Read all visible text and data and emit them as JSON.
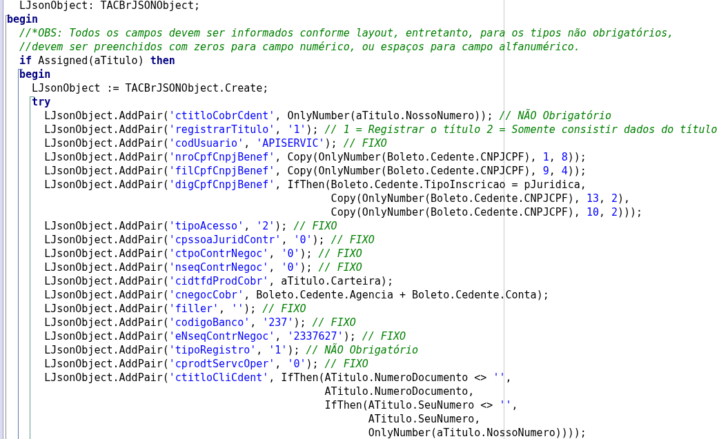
{
  "editor": {
    "lines": [
      {
        "tokens": [
          {
            "kind": "plain",
            "text": "  LJsonObject: TACBrJSONObject;"
          }
        ]
      },
      {
        "tokens": [
          {
            "kind": "keyword",
            "text": "begin"
          }
        ]
      },
      {
        "tokens": [
          {
            "kind": "comment",
            "text": "  //*OBS: Todos os campos devem ser informados conforme layout, entretanto, para os tipos não obrigatórios,"
          }
        ]
      },
      {
        "tokens": [
          {
            "kind": "comment",
            "text": "  //devem ser preenchidos com zeros para campo numérico, ou espaços para campo alfanumérico."
          }
        ]
      },
      {
        "tokens": [
          {
            "kind": "keyword",
            "text": "  if"
          },
          {
            "kind": "plain",
            "text": " Assigned(aTitulo) "
          },
          {
            "kind": "keyword",
            "text": "then"
          }
        ]
      },
      {
        "tokens": [
          {
            "kind": "keyword",
            "text": "  begin"
          }
        ]
      },
      {
        "tokens": [
          {
            "kind": "plain",
            "text": "    LJsonObject := TACBrJSONObject.Create;"
          }
        ]
      },
      {
        "tokens": [
          {
            "kind": "keyword",
            "text": "    try"
          }
        ]
      },
      {
        "tokens": [
          {
            "kind": "plain",
            "text": "      LJsonObject.AddPair("
          },
          {
            "kind": "string",
            "text": "'ctitloCobrCdent'"
          },
          {
            "kind": "plain",
            "text": ", OnlyNumber(aTitulo.NossoNumero)); "
          },
          {
            "kind": "comment",
            "text": "// NÃO Obrigatório"
          }
        ]
      },
      {
        "tokens": [
          {
            "kind": "plain",
            "text": "      LJsonObject.AddPair("
          },
          {
            "kind": "string",
            "text": "'registrarTitulo'"
          },
          {
            "kind": "plain",
            "text": ", "
          },
          {
            "kind": "string",
            "text": "'1'"
          },
          {
            "kind": "plain",
            "text": "); "
          },
          {
            "kind": "comment",
            "text": "// 1 = Registrar o título 2 = Somente consistir dados do título"
          }
        ]
      },
      {
        "tokens": [
          {
            "kind": "plain",
            "text": "      LJsonObject.AddPair("
          },
          {
            "kind": "string",
            "text": "'codUsuario'"
          },
          {
            "kind": "plain",
            "text": ", "
          },
          {
            "kind": "string",
            "text": "'APISERVIC'"
          },
          {
            "kind": "plain",
            "text": "); "
          },
          {
            "kind": "comment",
            "text": "// FIXO"
          }
        ]
      },
      {
        "tokens": [
          {
            "kind": "plain",
            "text": "      LJsonObject.AddPair("
          },
          {
            "kind": "string",
            "text": "'nroCpfCnpjBenef'"
          },
          {
            "kind": "plain",
            "text": ", Copy(OnlyNumber(Boleto.Cedente.CNPJCPF), "
          },
          {
            "kind": "number",
            "text": "1"
          },
          {
            "kind": "plain",
            "text": ", "
          },
          {
            "kind": "number",
            "text": "8"
          },
          {
            "kind": "plain",
            "text": "));"
          }
        ]
      },
      {
        "tokens": [
          {
            "kind": "plain",
            "text": "      LJsonObject.AddPair("
          },
          {
            "kind": "string",
            "text": "'filCpfCnpjBenef'"
          },
          {
            "kind": "plain",
            "text": ", Copy(OnlyNumber(Boleto.Cedente.CNPJCPF), "
          },
          {
            "kind": "number",
            "text": "9"
          },
          {
            "kind": "plain",
            "text": ", "
          },
          {
            "kind": "number",
            "text": "4"
          },
          {
            "kind": "plain",
            "text": "));"
          }
        ]
      },
      {
        "tokens": [
          {
            "kind": "plain",
            "text": "      LJsonObject.AddPair("
          },
          {
            "kind": "string",
            "text": "'digCpfCnpjBenef'"
          },
          {
            "kind": "plain",
            "text": ", IfThen(Boleto.Cedente.TipoInscricao = pJuridica,"
          }
        ]
      },
      {
        "tokens": [
          {
            "kind": "plain",
            "text": "                                                    Copy(OnlyNumber(Boleto.Cedente.CNPJCPF), "
          },
          {
            "kind": "number",
            "text": "13"
          },
          {
            "kind": "plain",
            "text": ", "
          },
          {
            "kind": "number",
            "text": "2"
          },
          {
            "kind": "plain",
            "text": "),"
          }
        ]
      },
      {
        "tokens": [
          {
            "kind": "plain",
            "text": "                                                    Copy(OnlyNumber(Boleto.Cedente.CNPJCPF), "
          },
          {
            "kind": "number",
            "text": "10"
          },
          {
            "kind": "plain",
            "text": ", "
          },
          {
            "kind": "number",
            "text": "2"
          },
          {
            "kind": "plain",
            "text": ")));"
          }
        ]
      },
      {
        "tokens": [
          {
            "kind": "plain",
            "text": "      LJsonObject.AddPair("
          },
          {
            "kind": "string",
            "text": "'tipoAcesso'"
          },
          {
            "kind": "plain",
            "text": ", "
          },
          {
            "kind": "string",
            "text": "'2'"
          },
          {
            "kind": "plain",
            "text": "); "
          },
          {
            "kind": "comment",
            "text": "// FIXO"
          }
        ]
      },
      {
        "tokens": [
          {
            "kind": "plain",
            "text": "      LJsonObject.AddPair("
          },
          {
            "kind": "string",
            "text": "'cpssoaJuridContr'"
          },
          {
            "kind": "plain",
            "text": ", "
          },
          {
            "kind": "string",
            "text": "'0'"
          },
          {
            "kind": "plain",
            "text": "); "
          },
          {
            "kind": "comment",
            "text": "// FIXO"
          }
        ]
      },
      {
        "tokens": [
          {
            "kind": "plain",
            "text": "      LJsonObject.AddPair("
          },
          {
            "kind": "string",
            "text": "'ctpoContrNegoc'"
          },
          {
            "kind": "plain",
            "text": ", "
          },
          {
            "kind": "string",
            "text": "'0'"
          },
          {
            "kind": "plain",
            "text": "); "
          },
          {
            "kind": "comment",
            "text": "// FIXO"
          }
        ]
      },
      {
        "tokens": [
          {
            "kind": "plain",
            "text": "      LJsonObject.AddPair("
          },
          {
            "kind": "string",
            "text": "'nseqContrNegoc'"
          },
          {
            "kind": "plain",
            "text": ", "
          },
          {
            "kind": "string",
            "text": "'0'"
          },
          {
            "kind": "plain",
            "text": "); "
          },
          {
            "kind": "comment",
            "text": "// FIXO"
          }
        ]
      },
      {
        "tokens": [
          {
            "kind": "plain",
            "text": "      LJsonObject.AddPair("
          },
          {
            "kind": "string",
            "text": "'cidtfdProdCobr'"
          },
          {
            "kind": "plain",
            "text": ", aTitulo.Carteira);"
          }
        ]
      },
      {
        "tokens": [
          {
            "kind": "plain",
            "text": "      LJsonObject.AddPair("
          },
          {
            "kind": "string",
            "text": "'cnegocCobr'"
          },
          {
            "kind": "plain",
            "text": ", Boleto.Cedente.Agencia + Boleto.Cedente.Conta);"
          }
        ]
      },
      {
        "tokens": [
          {
            "kind": "plain",
            "text": "      LJsonObject.AddPair("
          },
          {
            "kind": "string",
            "text": "'filler'"
          },
          {
            "kind": "plain",
            "text": ", "
          },
          {
            "kind": "string",
            "text": "''"
          },
          {
            "kind": "plain",
            "text": "); "
          },
          {
            "kind": "comment",
            "text": "// FIXO"
          }
        ]
      },
      {
        "tokens": [
          {
            "kind": "plain",
            "text": "      LJsonObject.AddPair("
          },
          {
            "kind": "string",
            "text": "'codigoBanco'"
          },
          {
            "kind": "plain",
            "text": ", "
          },
          {
            "kind": "string",
            "text": "'237'"
          },
          {
            "kind": "plain",
            "text": "); "
          },
          {
            "kind": "comment",
            "text": "// FIXO"
          }
        ]
      },
      {
        "tokens": [
          {
            "kind": "plain",
            "text": "      LJsonObject.AddPair("
          },
          {
            "kind": "string",
            "text": "'eNseqContrNegoc'"
          },
          {
            "kind": "plain",
            "text": ", "
          },
          {
            "kind": "string",
            "text": "'2337627'"
          },
          {
            "kind": "plain",
            "text": "); "
          },
          {
            "kind": "comment",
            "text": "// FIXO"
          }
        ]
      },
      {
        "tokens": [
          {
            "kind": "plain",
            "text": "      LJsonObject.AddPair("
          },
          {
            "kind": "string",
            "text": "'tipoRegistro'"
          },
          {
            "kind": "plain",
            "text": ", "
          },
          {
            "kind": "string",
            "text": "'1'"
          },
          {
            "kind": "plain",
            "text": "); "
          },
          {
            "kind": "comment",
            "text": "// NÃO Obrigatório"
          }
        ]
      },
      {
        "tokens": [
          {
            "kind": "plain",
            "text": "      LJsonObject.AddPair("
          },
          {
            "kind": "string",
            "text": "'cprodtServcOper'"
          },
          {
            "kind": "plain",
            "text": ", "
          },
          {
            "kind": "string",
            "text": "'0'"
          },
          {
            "kind": "plain",
            "text": "); "
          },
          {
            "kind": "comment",
            "text": "// FIXO"
          }
        ]
      },
      {
        "tokens": [
          {
            "kind": "plain",
            "text": "      LJsonObject.AddPair("
          },
          {
            "kind": "string",
            "text": "'ctitloCliCdent'"
          },
          {
            "kind": "plain",
            "text": ", IfThen(ATitulo.NumeroDocumento <> "
          },
          {
            "kind": "string",
            "text": "''"
          },
          {
            "kind": "plain",
            "text": ","
          }
        ]
      },
      {
        "tokens": [
          {
            "kind": "plain",
            "text": "                                                   ATitulo.NumeroDocumento,"
          }
        ]
      },
      {
        "tokens": [
          {
            "kind": "plain",
            "text": "                                                   IfThen(ATitulo.SeuNumero <> "
          },
          {
            "kind": "string",
            "text": "''"
          },
          {
            "kind": "plain",
            "text": ","
          }
        ]
      },
      {
        "tokens": [
          {
            "kind": "plain",
            "text": "                                                          ATitulo.SeuNumero,"
          }
        ]
      },
      {
        "tokens": [
          {
            "kind": "plain",
            "text": "                                                          OnlyNumber(aTitulo.NossoNumero))));"
          }
        ]
      }
    ]
  }
}
